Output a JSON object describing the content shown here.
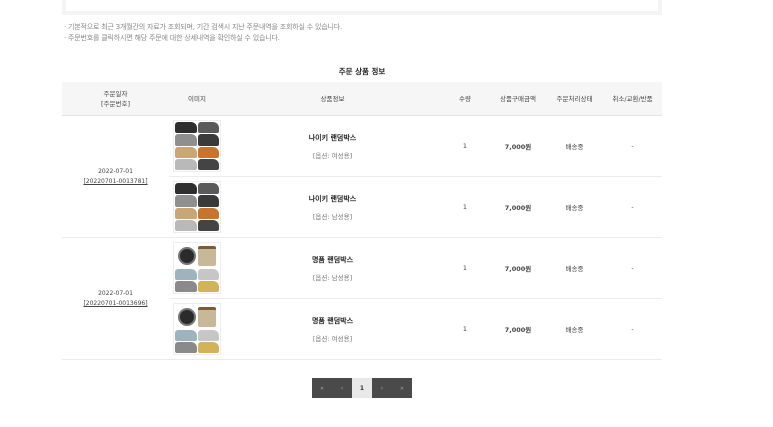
{
  "notices": [
    "· 기본적으로 최근 3개월간의 자료가 조회되며, 기간 검색시 지난 주문내역을 조회하실 수 있습니다.",
    "· 주문번호를 클릭하시면 해당 주문에 대한 상세내역을 확인하실 수 있습니다."
  ],
  "section_title": "주문 상품 정보",
  "columns": {
    "date_line1": "주문일자",
    "date_line2": "[주문번호]",
    "image": "이미지",
    "info": "상품정보",
    "qty": "수량",
    "price": "상품구매금액",
    "status": "주문처리상태",
    "cancel": "취소/교환/반품"
  },
  "orders": [
    {
      "date": "2022-07-01",
      "order_no": "[20220701-0013781]",
      "items": [
        {
          "name": "나이키 랜덤박스",
          "option": "[옵션: 여성용]",
          "qty": "1",
          "price": "7,000원",
          "status": "배송중",
          "cancel": "-",
          "thumb": "sneakers-icon"
        },
        {
          "name": "나이키 랜덤박스",
          "option": "[옵션: 남성용]",
          "qty": "1",
          "price": "7,000원",
          "status": "배송중",
          "cancel": "-",
          "thumb": "sneakers-icon"
        }
      ]
    },
    {
      "date": "2022-07-01",
      "order_no": "[20220701-0013696]",
      "items": [
        {
          "name": "명품 랜덤박스",
          "option": "[옵션: 남성용]",
          "qty": "1",
          "price": "7,000원",
          "status": "배송중",
          "cancel": "-",
          "thumb": "luxury-icon"
        },
        {
          "name": "명품 랜덤박스",
          "option": "[옵션: 여성용]",
          "qty": "1",
          "price": "7,000원",
          "status": "배송중",
          "cancel": "-",
          "thumb": "luxury-icon"
        }
      ]
    }
  ],
  "pagination": {
    "first": "«",
    "prev": "‹",
    "current": "1",
    "next": "›",
    "last": "»"
  },
  "colors": {
    "status": "#4a5ec4",
    "pager_dark": "#4a4a4a",
    "header_bg": "#f6f6f6"
  }
}
